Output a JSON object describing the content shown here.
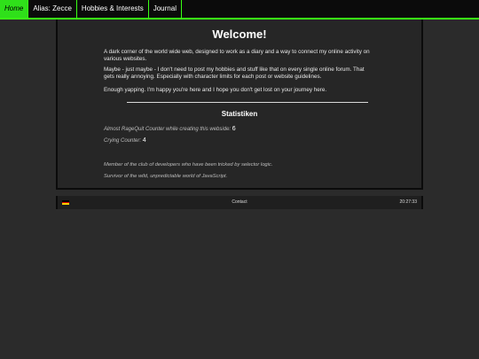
{
  "nav": {
    "items": [
      {
        "label": "Home",
        "active": true
      },
      {
        "label": "Alias: Zecce",
        "active": false
      },
      {
        "label": "Hobbies & Interests",
        "active": false
      },
      {
        "label": "Journal",
        "active": false
      }
    ]
  },
  "main": {
    "title": "Welcome!",
    "paragraphs": [
      "A dark corner of the world wide web, designed to work as a diary and a way to connect my online activity on various websites.",
      "Maybe - just maybe - I don't need to post my hobbies and stuff like that on every single online forum. That gets really annoying. Especially with character limits for each post or website guidelines.",
      "Enough yapping. I'm happy you're here and I hope you don't get lost on your journey here."
    ],
    "stats_title": "Statistiken",
    "stats": [
      {
        "label": "Almost RageQuit Counter while creating this webside:",
        "value": "6"
      },
      {
        "label": "Crying Counter:",
        "value": "4"
      }
    ],
    "notes": [
      "Member of the club of developers who have been tricked by selector logic.",
      "Survivor of the wild, unpredictable world of JavaScript."
    ]
  },
  "footer": {
    "contact": "Contact",
    "time": "20:27:33",
    "flag_colors": [
      "#000000",
      "#dd0000",
      "#ffce00"
    ]
  },
  "colors": {
    "accent": "#39ff14",
    "background": "#2b2b2b",
    "panel": "#262626"
  }
}
